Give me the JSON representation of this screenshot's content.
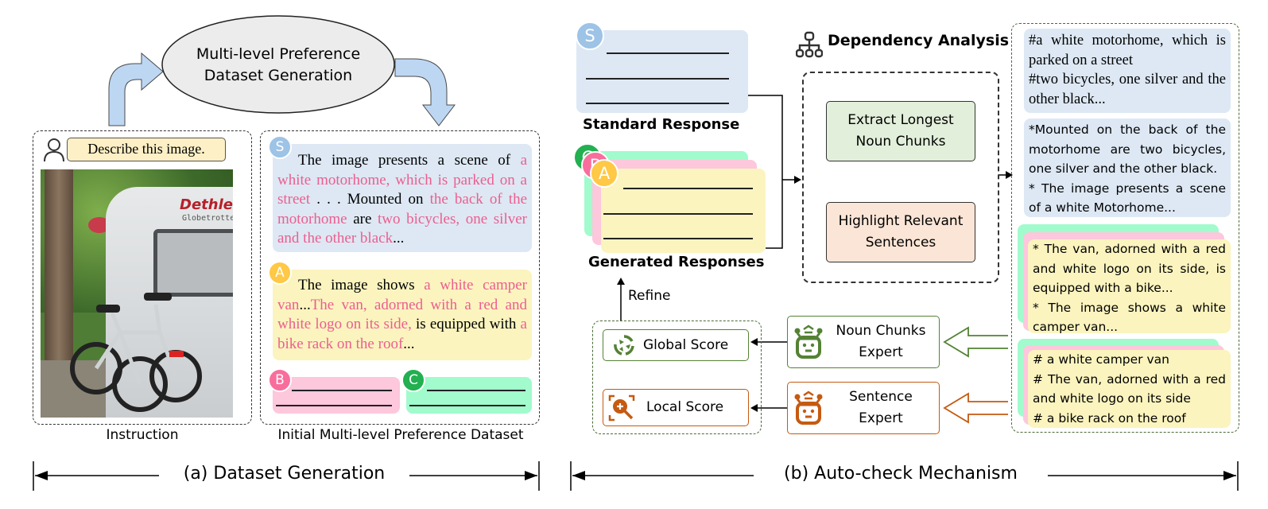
{
  "panel_a": {
    "ellipse_label": "Multi-level Preference Dataset Generation",
    "ellipse_line1": "Multi-level Preference",
    "ellipse_line2": "Dataset Generation",
    "instruction_prompt": "Describe this image.",
    "instruction_caption": "Instruction",
    "dataset_caption": "Initial Multi-level Preference Dataset",
    "photo_description": "White Dethleffs Globetrotter motorhome with two bicycles mounted on the back rack, parked under trees",
    "photo_brand_text": "Dethleffs",
    "photo_model_text": "Globetrotter",
    "response_S": {
      "badge": "S",
      "segments": [
        {
          "text": "The image presents a scene of ",
          "highlight": false
        },
        {
          "text": "a white motorhome, which is parked on a street",
          "highlight": true
        },
        {
          "text": " . . . Mounted on ",
          "highlight": false
        },
        {
          "text": "the back of the motorhome",
          "highlight": true
        },
        {
          "text": " are ",
          "highlight": false
        },
        {
          "text": "two bicycles, one silver and the other black",
          "highlight": true
        },
        {
          "text": "...",
          "highlight": false
        }
      ]
    },
    "response_A": {
      "badge": "A",
      "segments": [
        {
          "text": "The image shows ",
          "highlight": false
        },
        {
          "text": "a white camper van",
          "highlight": true
        },
        {
          "text": "...",
          "highlight": false
        },
        {
          "text": "The van, adorned with a red and white logo on its side,",
          "highlight": true
        },
        {
          "text": " is equipped with ",
          "highlight": false
        },
        {
          "text": "a bike rack on the roof",
          "highlight": true
        },
        {
          "text": "...",
          "highlight": false
        }
      ]
    },
    "response_B": {
      "badge": "B"
    },
    "response_C": {
      "badge": "C"
    },
    "section_title": "(a) Dataset Generation"
  },
  "panel_b": {
    "standard_badge": "S",
    "standard_caption": "Standard Response",
    "generated_badges": [
      "C",
      "B",
      "A"
    ],
    "generated_caption": "Generated Responses",
    "dependency_title": "Dependency Analysis",
    "extract_box": "Extract Longest Noun Chunks",
    "extract_line1": "Extract Longest",
    "extract_line2": "Noun Chunks",
    "highlight_box": "Highlight Relevant Sentences",
    "highlight_line1": "Highlight Relevant",
    "highlight_line2": "Sentences",
    "refine_label": "Refine",
    "global_score": "Global Score",
    "local_score": "Local Score",
    "noun_expert_line1": "Noun Chunks",
    "noun_expert_line2": "Expert",
    "sentence_expert_line1": "Sentence",
    "sentence_expert_line2": "Expert",
    "standard_noun_chunks": [
      "#a white motorhome, which is parked on a street",
      "#two bicycles, one silver and the other black..."
    ],
    "standard_sentences": [
      "*Mounted on the back of the motorhome are two bicycles, one silver and the other black.",
      "* The image presents a scene of a white Motorhome..."
    ],
    "generated_sentences": [
      "* The van, adorned with a red and white logo on its side, is equipped with a bike...",
      "* The image shows a white camper van..."
    ],
    "generated_noun_chunks": [
      "# a white camper van",
      "# The van, adorned with a red and white logo on its side",
      "# a bike rack on the roof"
    ],
    "section_title": "(b) Auto-check Mechanism"
  },
  "colors": {
    "arrow_blue": "#bdd7f3",
    "ellipse_fill": "#ececec",
    "standard_blue": "#dde8f4",
    "answer_yellow": "#fbf4bf",
    "answer_pink": "#fdc7dc",
    "answer_green": "#a1fbcd",
    "highlight_pink": "#ec5e8f",
    "noun_green": "#548235",
    "sentence_orange": "#c55a11",
    "extract_fill": "#e2efda",
    "highlight_fill": "#fbe5d6"
  }
}
